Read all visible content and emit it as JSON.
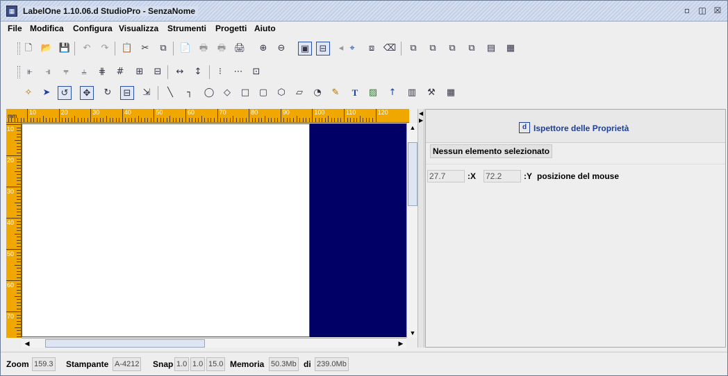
{
  "window": {
    "title": "LabelOne 1.10.06.d StudioPro - SenzaNome"
  },
  "menu": [
    "File",
    "Modifica",
    "Configura",
    "Visualizza",
    "Strumenti",
    "Progetti",
    "Aiuto"
  ],
  "ruler": {
    "unit": "mm",
    "h_labels": [
      "10",
      "20",
      "30",
      "40",
      "50",
      "60",
      "70",
      "80",
      "90",
      "100",
      "110",
      "120"
    ],
    "v_labels": [
      "10",
      "20",
      "30",
      "40",
      "50",
      "60",
      "70"
    ]
  },
  "properties": {
    "title": "Ispettore delle Proprietà",
    "no_selection": "Nessun elemento selezionato",
    "mouse_x": "27.7",
    "x_label": ":X",
    "mouse_y": "72.2",
    "y_label": ":Y",
    "mouse_label": "posizione del mouse"
  },
  "status": {
    "zoom_label": "Zoom",
    "zoom": "159.3",
    "printer_label": "Stampante",
    "printer": "A-4212",
    "snap_label": "Snap",
    "snap": [
      "1.0",
      "1.0",
      "15.0"
    ],
    "memory_label": "Memoria",
    "memory_used": "50.3Mb",
    "of_label": "di",
    "memory_total": "239.0Mb"
  },
  "colors": {
    "ruler": "#f0a800",
    "offarea": "#000066",
    "accent": "#1a3fa0"
  }
}
